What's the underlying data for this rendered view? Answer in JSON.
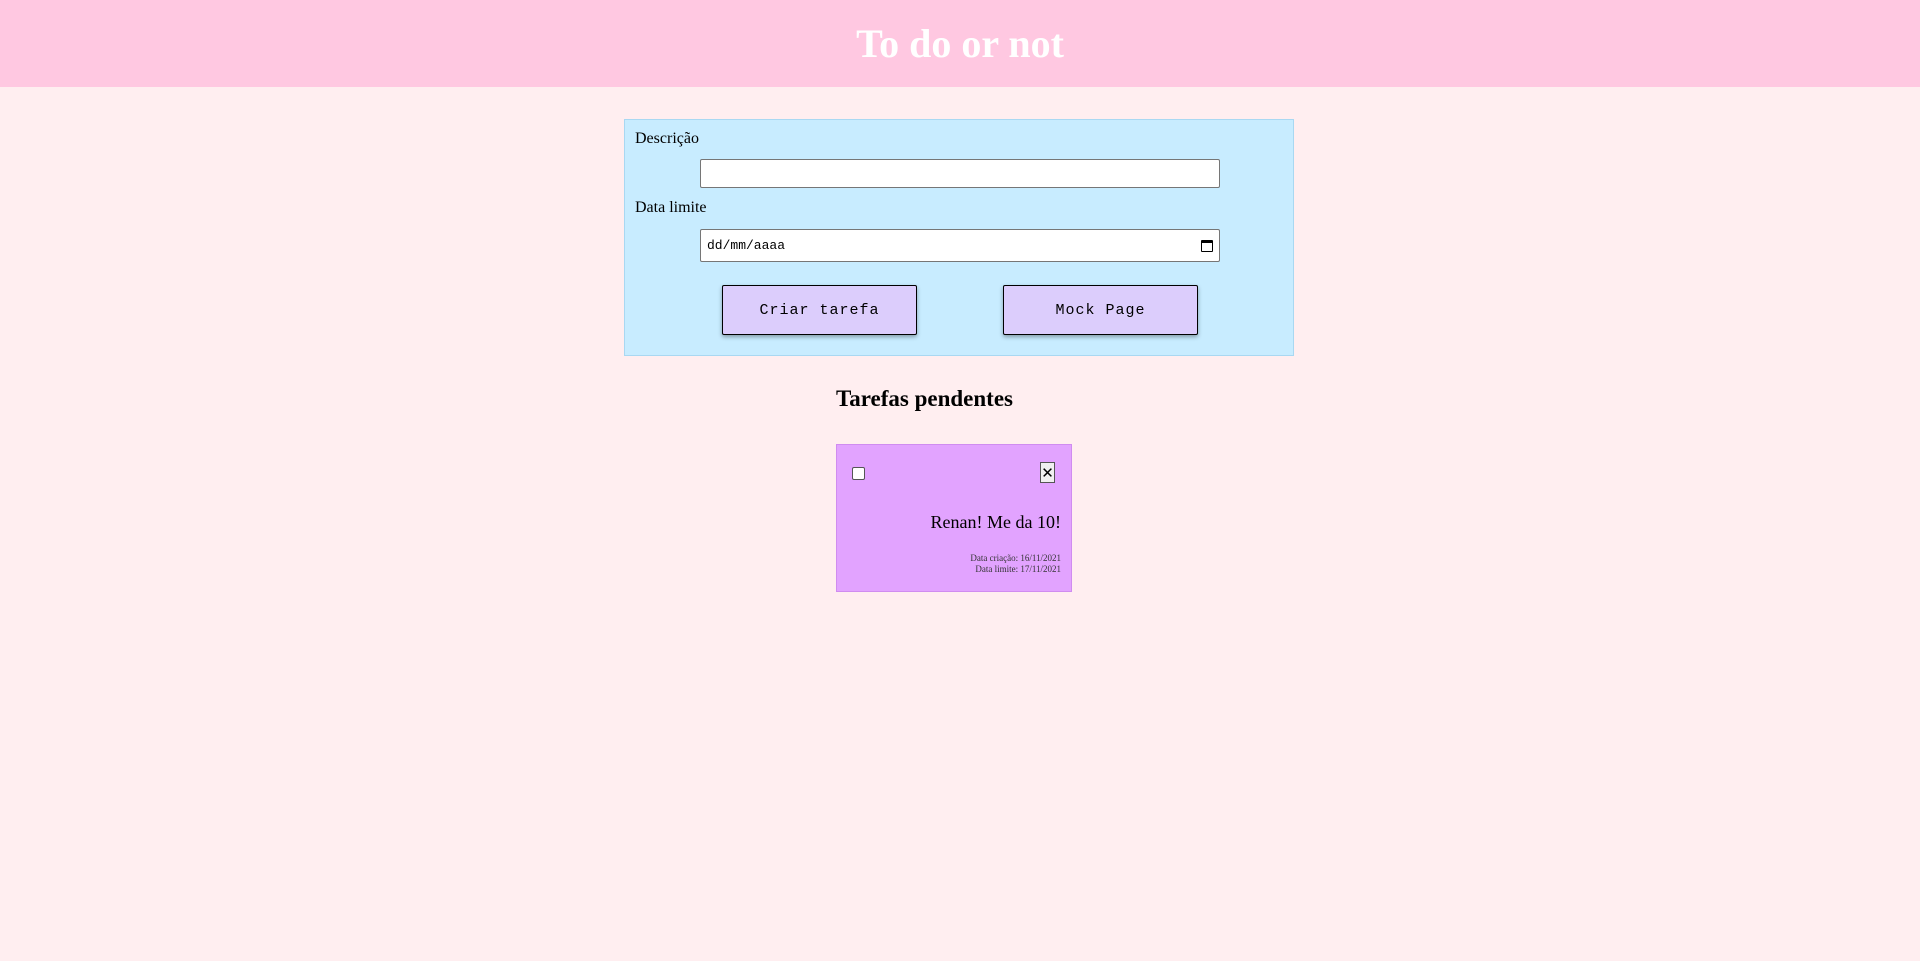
{
  "header": {
    "title": "To do or not"
  },
  "form": {
    "description_label": "Descrição",
    "description_value": "",
    "date_label": "Data limite",
    "date_placeholder": "dd/mm/aaaa",
    "create_button": "Criar tarefa",
    "mock_button": "Mock Page"
  },
  "tasks": {
    "section_title": "Tarefas pendentes",
    "items": [
      {
        "text": "Renan! Me da 10!",
        "created": "Data criação: 16/11/2021",
        "deadline": "Data limite: 17/11/2021",
        "done": false,
        "delete_glyph": "✕"
      }
    ]
  },
  "colors": {
    "header_bg": "#ffc8e1",
    "page_bg": "#ffeef0",
    "form_bg": "#c8ecff",
    "button_bg": "#dccdfc",
    "card_bg": "#e2a3ff"
  }
}
